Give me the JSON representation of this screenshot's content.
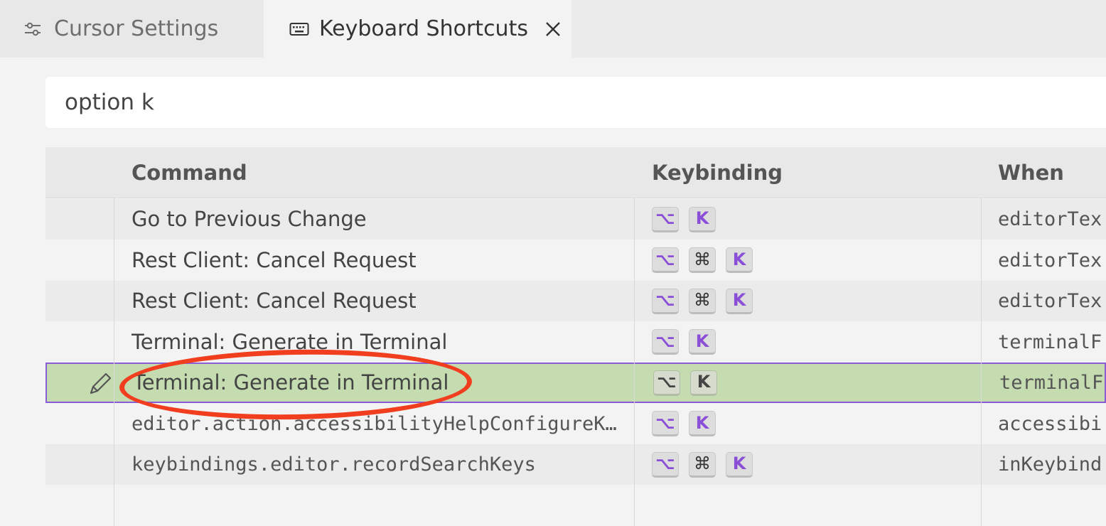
{
  "tabs": [
    {
      "label": "Cursor Settings",
      "icon": "settings-sliders-icon"
    },
    {
      "label": "Keyboard Shortcuts",
      "icon": "keyboard-icon",
      "active": true
    }
  ],
  "search": {
    "value": "option k"
  },
  "table": {
    "headers": {
      "command": "Command",
      "keybinding": "Keybinding",
      "when": "When"
    },
    "rows": [
      {
        "command": "Go to Previous Change",
        "keys": [
          "⌥",
          "K"
        ],
        "when": "editorTex"
      },
      {
        "command": "Rest Client: Cancel Request",
        "keys": [
          "⌥",
          "⌘",
          "K"
        ],
        "when": "editorTex"
      },
      {
        "command": "Rest Client: Cancel Request",
        "keys": [
          "⌥",
          "⌘",
          "K"
        ],
        "when": "editorTex"
      },
      {
        "command": "Terminal: Generate in Terminal",
        "keys": [
          "⌥",
          "K"
        ],
        "when": "terminalF"
      },
      {
        "command": "Terminal: Generate in Terminal",
        "keys": [
          "⌥",
          "K"
        ],
        "when": "terminalF",
        "selected": true
      },
      {
        "command": "editor.action.accessibilityHelpConfigureK…",
        "keys": [
          "⌥",
          "K"
        ],
        "when": "accessibi",
        "mono": true
      },
      {
        "command": "keybindings.editor.recordSearchKeys",
        "keys": [
          "⌥",
          "⌘",
          "K"
        ],
        "when": "inKeybind",
        "mono": true
      }
    ]
  },
  "colors": {
    "selection": "#c5dcb0",
    "selection_border": "#8a5cd6",
    "key_accent": "#8a4fd6",
    "annotation": "#f03e1e"
  }
}
